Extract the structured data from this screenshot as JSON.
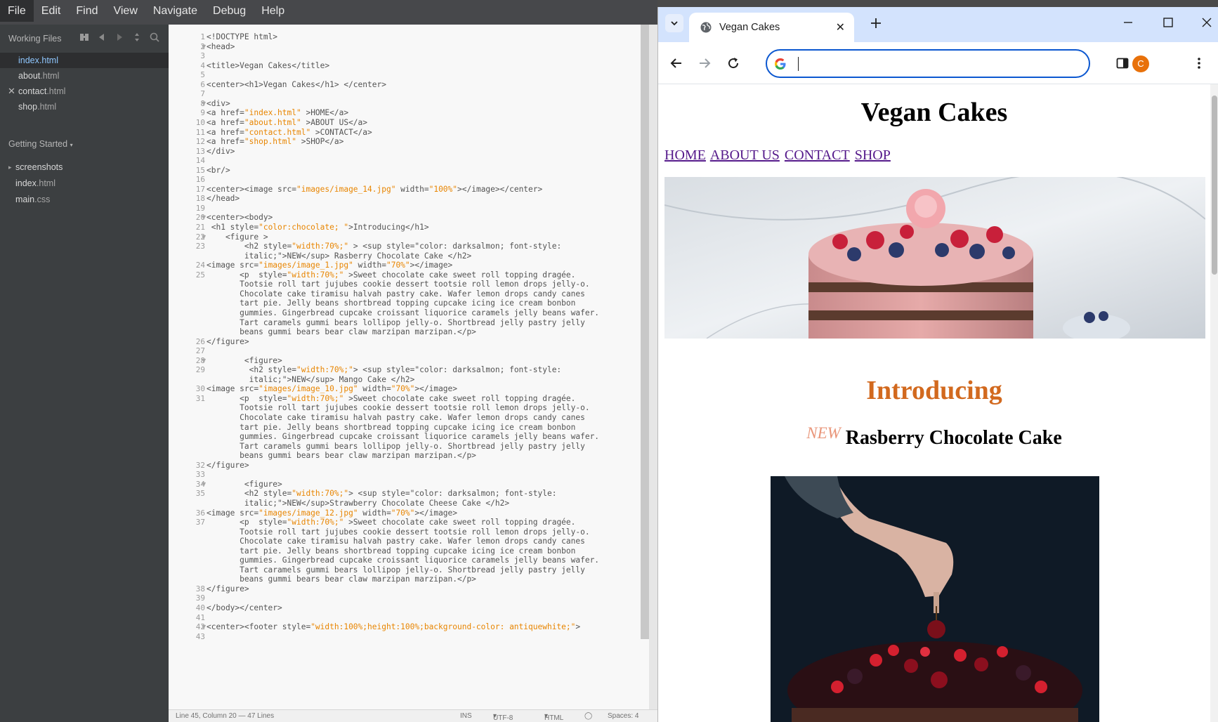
{
  "editor": {
    "menu": [
      "File",
      "Edit",
      "Find",
      "View",
      "Navigate",
      "Debug",
      "Help"
    ],
    "working_files_label": "Working Files",
    "working_files": [
      {
        "name": "index",
        "ext": ".html"
      },
      {
        "name": "about",
        "ext": ".html"
      },
      {
        "name": "contact",
        "ext": ".html"
      },
      {
        "name": "shop",
        "ext": ".html"
      }
    ],
    "project_label": "Getting Started",
    "project_tree": [
      {
        "name": "screenshots",
        "ext": ""
      },
      {
        "name": "index",
        "ext": ".html"
      },
      {
        "name": "main",
        "ext": ".css"
      }
    ],
    "code_lines": [
      "<!DOCTYPE html>",
      "<head>",
      "",
      "<title>Vegan Cakes</title>",
      "",
      "<center><h1>Vegan Cakes</h1> </center>",
      "",
      "<div>",
      "<a href=\"index.html\" >HOME</a>",
      "<a href=\"about.html\" >ABOUT US</a>",
      "<a href=\"contact.html\" >CONTACT</a>",
      "<a href=\"shop.html\" >SHOP</a>",
      "</div>",
      "",
      "<br/>",
      "",
      "<center><image src=\"images/image_14.jpg\" width=\"100%\"></image></center>",
      "</head>",
      "",
      "<center><body>",
      " <h1 style=\"color:chocolate; \">Introducing</h1>",
      "    <figure >",
      "        <h2 style=\"width:70%;\" > <sup style=\"color: darksalmon; font-style:",
      "        italic;\">NEW</sup> Rasberry Chocolate Cake </h2>",
      "<image src=\"images/image_1.jpg\" width=\"70%\"></image>",
      "       <p  style=\"width:70%;\" >Sweet chocolate cake sweet roll topping dragée.",
      "       Tootsie roll tart jujubes cookie dessert tootsie roll lemon drops jelly-o.",
      "       Chocolate cake tiramisu halvah pastry cake. Wafer lemon drops candy canes",
      "       tart pie. Jelly beans shortbread topping cupcake icing ice cream bonbon",
      "       gummies. Gingerbread cupcake croissant liquorice caramels jelly beans wafer.",
      "       Tart caramels gummi bears lollipop jelly-o. Shortbread jelly pastry jelly",
      "       beans gummi bears bear claw marzipan marzipan.</p>",
      "</figure>",
      "",
      "        <figure>",
      "         <h2 style=\"width:70%;\"> <sup style=\"color: darksalmon; font-style:",
      "         italic;\">NEW</sup> Mango Cake </h2>",
      "<image src=\"images/image_10.jpg\" width=\"70%\"></image>",
      "       <p  style=\"width:70%;\" >Sweet chocolate cake sweet roll topping dragée.",
      "       Tootsie roll tart jujubes cookie dessert tootsie roll lemon drops jelly-o.",
      "       Chocolate cake tiramisu halvah pastry cake. Wafer lemon drops candy canes",
      "       tart pie. Jelly beans shortbread topping cupcake icing ice cream bonbon",
      "       gummies. Gingerbread cupcake croissant liquorice caramels jelly beans wafer.",
      "       Tart caramels gummi bears lollipop jelly-o. Shortbread jelly pastry jelly",
      "       beans gummi bears bear claw marzipan marzipan.</p>",
      "</figure>",
      "",
      "        <figure>",
      "        <h2 style=\"width:70%;\"> <sup style=\"color: darksalmon; font-style:",
      "        italic;\">NEW</sup>Strawberry Chocolate Cheese Cake </h2>",
      "<image src=\"images/image_12.jpg\" width=\"70%\"></image>",
      "       <p  style=\"width:70%;\" >Sweet chocolate cake sweet roll topping dragée.",
      "       Tootsie roll tart jujubes cookie dessert tootsie roll lemon drops jelly-o.",
      "       Chocolate cake tiramisu halvah pastry cake. Wafer lemon drops candy canes",
      "       tart pie. Jelly beans shortbread topping cupcake icing ice cream bonbon",
      "       gummies. Gingerbread cupcake croissant liquorice caramels jelly beans wafer.",
      "       Tart caramels gummi bears lollipop jelly-o. Shortbread jelly pastry jelly",
      "       beans gummi bears bear claw marzipan marzipan.</p>",
      "</figure>",
      "",
      "</body></center>",
      "",
      "<center><footer style=\"width:100%;height:100%;background-color: antiquewhite;\">",
      ""
    ],
    "line_numbers": [
      "1",
      "2",
      "3",
      "4",
      "5",
      "6",
      "7",
      "8",
      "9",
      "10",
      "11",
      "12",
      "13",
      "14",
      "15",
      "16",
      "17",
      "18",
      "19",
      "20",
      "21",
      "22",
      "23",
      "",
      "24",
      "25",
      "",
      "",
      "",
      "",
      "",
      "",
      "26",
      "27",
      "28",
      "29",
      "",
      "30",
      "31",
      "",
      "",
      "",
      "",
      "",
      "",
      "32",
      "33",
      "34",
      "35",
      "",
      "36",
      "37",
      "",
      "",
      "",
      "",
      "",
      "",
      "38",
      "39",
      "40",
      "41",
      "42",
      "43"
    ],
    "fold_lines": [
      2,
      8,
      20,
      22,
      28,
      34,
      42
    ],
    "status": {
      "position": "Line 45, Column 20 — 47 Lines",
      "mode": "INS",
      "encoding": "UTF-8",
      "language": "HTML",
      "spaces": "Spaces: 4"
    }
  },
  "browser": {
    "tab_title": "Vegan Cakes",
    "avatar_initial": "C",
    "address_value": "",
    "page": {
      "title": "Vegan Cakes",
      "nav": [
        "HOME",
        "ABOUT US",
        "CONTACT",
        "SHOP"
      ],
      "intro": "Introducing",
      "product_new_tag": "NEW",
      "product_name": "Rasberry Chocolate Cake"
    }
  }
}
